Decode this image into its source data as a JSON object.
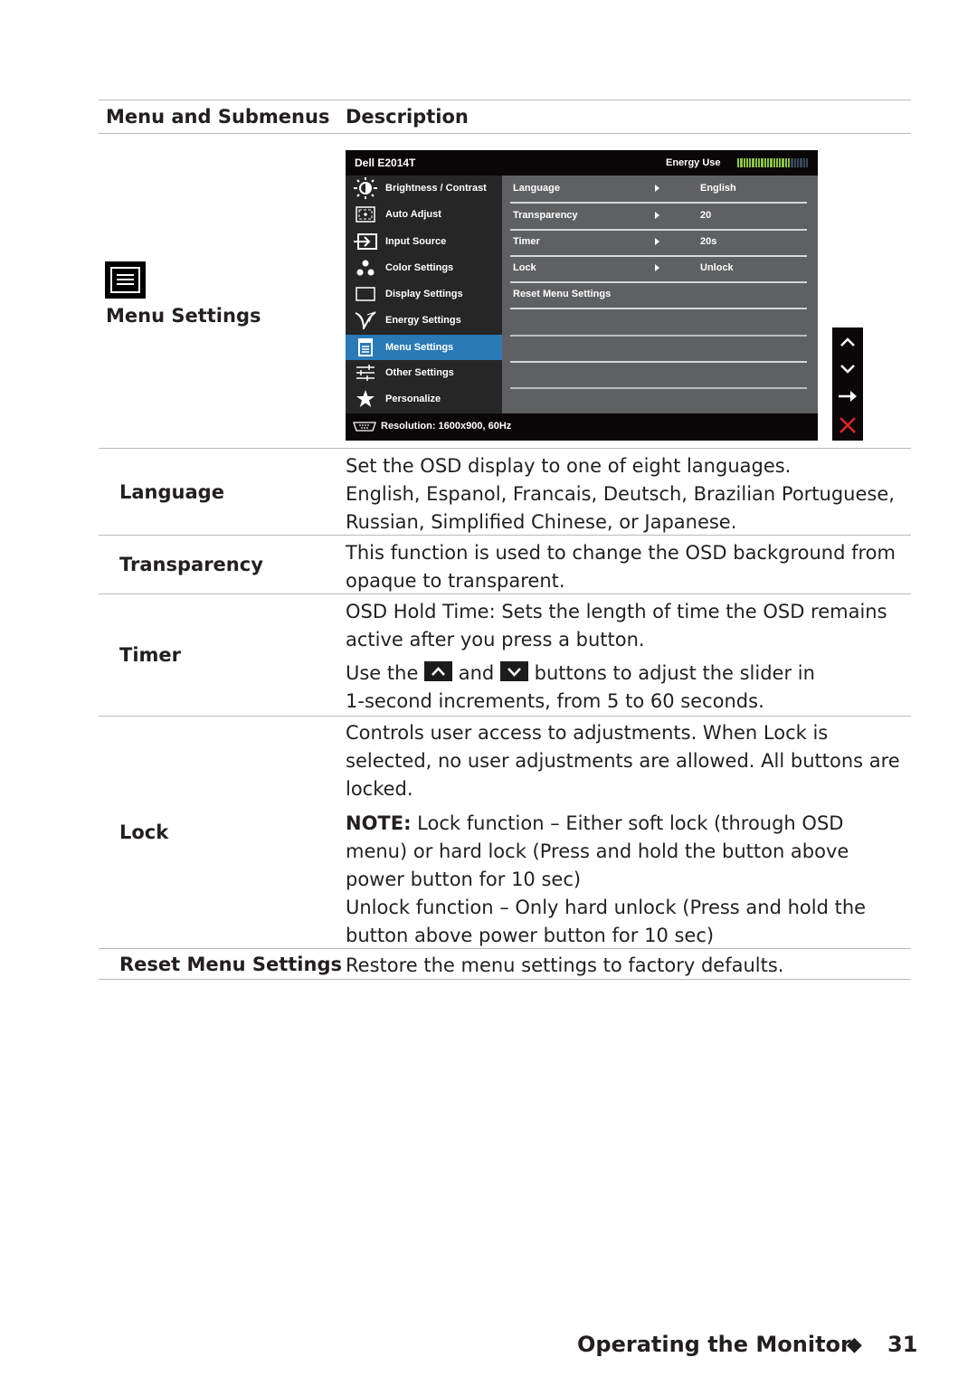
{
  "table": {
    "headers": [
      "Menu and Submenus",
      "Description"
    ],
    "section": {
      "icon": "menu-settings-icon",
      "title": "Menu Settings"
    },
    "rows": [
      {
        "label": "Language",
        "lines": [
          "Set the OSD display to one of eight languages.",
          "English, Espanol, Francais, Deutsch, Brazilian Portuguese,",
          "Russian, Simplified Chinese, or Japanese."
        ]
      },
      {
        "label": "Transparency",
        "lines": [
          "This function is used to change the OSD background from",
          "opaque to transparent."
        ]
      },
      {
        "label": "Timer",
        "lines": [
          "OSD Hold Time: Sets the length of time the OSD remains",
          "active after you press a button."
        ],
        "usage": {
          "prefix": "Use the",
          "up_icon": "up-button-icon",
          "mid": "and",
          "down_icon": "down-button-icon",
          "suffix": "buttons to adjust the slider in",
          "line2": "1-second increments, from 5 to 60 seconds."
        }
      },
      {
        "label": "Lock",
        "lines": [
          "Controls user access to adjustments. When Lock is",
          "selected, no user adjustments are allowed. All buttons are",
          "locked."
        ],
        "note_label": "NOTE:",
        "note_lines": [
          " Lock function – Either soft lock (through OSD",
          "menu) or hard lock (Press and hold the button above",
          "power button for 10 sec)",
          "Unlock function – Only hard unlock (Press and hold the",
          "button above power button for 10 sec)"
        ]
      },
      {
        "label": "Reset Menu Settings",
        "lines": [
          "Restore the menu settings to factory defaults."
        ]
      }
    ]
  },
  "osd": {
    "model": "Dell E2014T",
    "energy_label": "Energy Use",
    "energy_level": 0.75,
    "energy_segments": 24,
    "colors": {
      "accent": "#2a7ab8",
      "energy_on": "#8cc63f",
      "energy_off": "#3a4a5c",
      "close": "#e0262b"
    },
    "menu": [
      {
        "label": "Brightness / Contrast",
        "icon": "brightness-icon",
        "active": false
      },
      {
        "label": "Auto Adjust",
        "icon": "auto-adjust-icon",
        "active": false
      },
      {
        "label": "Input Source",
        "icon": "input-source-icon",
        "active": false
      },
      {
        "label": "Color Settings",
        "icon": "color-settings-icon",
        "active": false
      },
      {
        "label": "Display Settings",
        "icon": "display-settings-icon",
        "active": false
      },
      {
        "label": "Energy Settings",
        "icon": "energy-settings-icon",
        "active": false
      },
      {
        "label": "Menu Settings",
        "icon": "menu-settings-icon",
        "active": true
      },
      {
        "label": "Other Settings",
        "icon": "other-settings-icon",
        "active": false
      },
      {
        "label": "Personalize",
        "icon": "star-icon",
        "active": false
      }
    ],
    "submenu": [
      {
        "label": "Language",
        "value": "English",
        "arrow": true
      },
      {
        "label": "Transparency",
        "value": "20",
        "arrow": true
      },
      {
        "label": "Timer",
        "value": "20s",
        "arrow": true
      },
      {
        "label": "Lock",
        "value": "Unlock",
        "arrow": true
      },
      {
        "label": "Reset Menu Settings",
        "value": "",
        "arrow": false
      },
      {
        "label": "",
        "value": "",
        "arrow": false
      },
      {
        "label": "",
        "value": "",
        "arrow": false
      },
      {
        "label": "",
        "value": "",
        "arrow": false
      }
    ],
    "resolution": "Resolution:  1600x900, 60Hz",
    "nav_buttons": [
      "up-arrow-icon",
      "down-arrow-icon",
      "right-arrow-icon",
      "close-icon"
    ]
  },
  "footer": {
    "section": "Operating the Monitor",
    "separator": "◆",
    "page": "31"
  }
}
